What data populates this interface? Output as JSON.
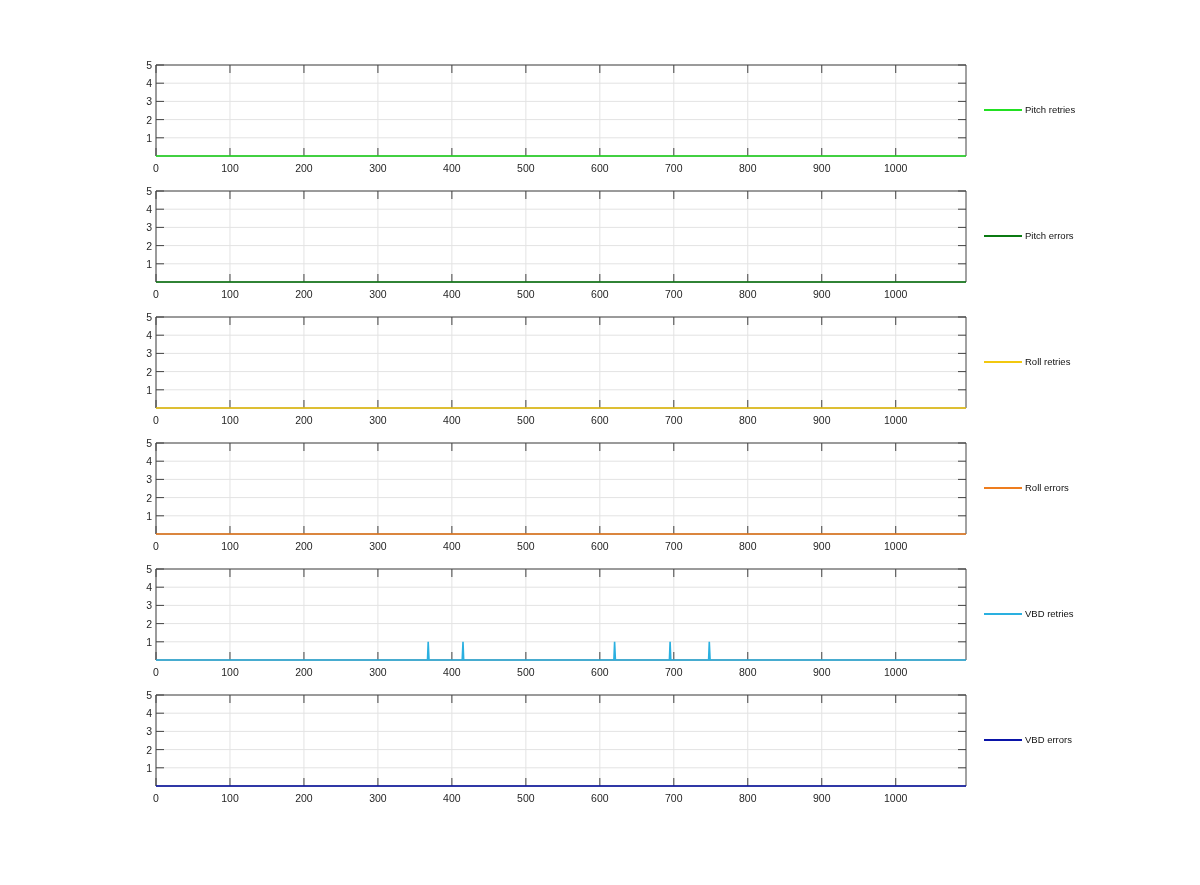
{
  "charts": [
    {
      "chart_data": {
        "type": "line",
        "grid": true,
        "xlim": [
          0,
          1095
        ],
        "ylim": [
          0,
          5
        ],
        "xticks": [
          0,
          100,
          200,
          300,
          400,
          500,
          600,
          700,
          800,
          900,
          1000
        ],
        "yticks": [
          1,
          2,
          3,
          4,
          5
        ],
        "x": [
          0,
          1095
        ],
        "series": [
          {
            "name": "Pitch retries",
            "color": "#22e022",
            "values": [
              0,
              0
            ]
          }
        ]
      }
    },
    {
      "chart_data": {
        "type": "line",
        "grid": true,
        "xlim": [
          0,
          1095
        ],
        "ylim": [
          0,
          5
        ],
        "xticks": [
          0,
          100,
          200,
          300,
          400,
          500,
          600,
          700,
          800,
          900,
          1000
        ],
        "yticks": [
          1,
          2,
          3,
          4,
          5
        ],
        "x": [
          0,
          1095
        ],
        "series": [
          {
            "name": "Pitch errors",
            "color": "#0b7a12",
            "values": [
              0,
              0
            ]
          }
        ]
      }
    },
    {
      "chart_data": {
        "type": "line",
        "grid": true,
        "xlim": [
          0,
          1095
        ],
        "ylim": [
          0,
          5
        ],
        "xticks": [
          0,
          100,
          200,
          300,
          400,
          500,
          600,
          700,
          800,
          900,
          1000
        ],
        "yticks": [
          1,
          2,
          3,
          4,
          5
        ],
        "x": [
          0,
          1095
        ],
        "series": [
          {
            "name": "Roll retries",
            "color": "#f2c80f",
            "values": [
              0,
              0
            ]
          }
        ]
      }
    },
    {
      "chart_data": {
        "type": "line",
        "grid": true,
        "xlim": [
          0,
          1095
        ],
        "ylim": [
          0,
          5
        ],
        "xticks": [
          0,
          100,
          200,
          300,
          400,
          500,
          600,
          700,
          800,
          900,
          1000
        ],
        "yticks": [
          1,
          2,
          3,
          4,
          5
        ],
        "x": [
          0,
          1095
        ],
        "series": [
          {
            "name": "Roll errors",
            "color": "#ee7d1e",
            "values": [
              0,
              0
            ]
          }
        ]
      }
    },
    {
      "chart_data": {
        "type": "line",
        "grid": true,
        "xlim": [
          0,
          1095
        ],
        "ylim": [
          0,
          5
        ],
        "xticks": [
          0,
          100,
          200,
          300,
          400,
          500,
          600,
          700,
          800,
          900,
          1000
        ],
        "yticks": [
          1,
          2,
          3,
          4,
          5
        ],
        "x": [
          0,
          367,
          368,
          369,
          414,
          415,
          416,
          619,
          620,
          621,
          694,
          695,
          696,
          747,
          748,
          749,
          1095
        ],
        "series": [
          {
            "name": "VBD retries",
            "color": "#2ab0e0",
            "values": [
              0,
              0,
              1,
              0,
              0,
              1,
              0,
              0,
              1,
              0,
              0,
              1,
              0,
              0,
              1,
              0,
              0
            ]
          }
        ]
      }
    },
    {
      "chart_data": {
        "type": "line",
        "grid": true,
        "xlim": [
          0,
          1095
        ],
        "ylim": [
          0,
          5
        ],
        "xticks": [
          0,
          100,
          200,
          300,
          400,
          500,
          600,
          700,
          800,
          900,
          1000
        ],
        "yticks": [
          1,
          2,
          3,
          4,
          5
        ],
        "x": [
          0,
          1095
        ],
        "series": [
          {
            "name": "VBD errors",
            "color": "#0a14a8",
            "values": [
              0,
              0
            ]
          }
        ]
      }
    }
  ]
}
